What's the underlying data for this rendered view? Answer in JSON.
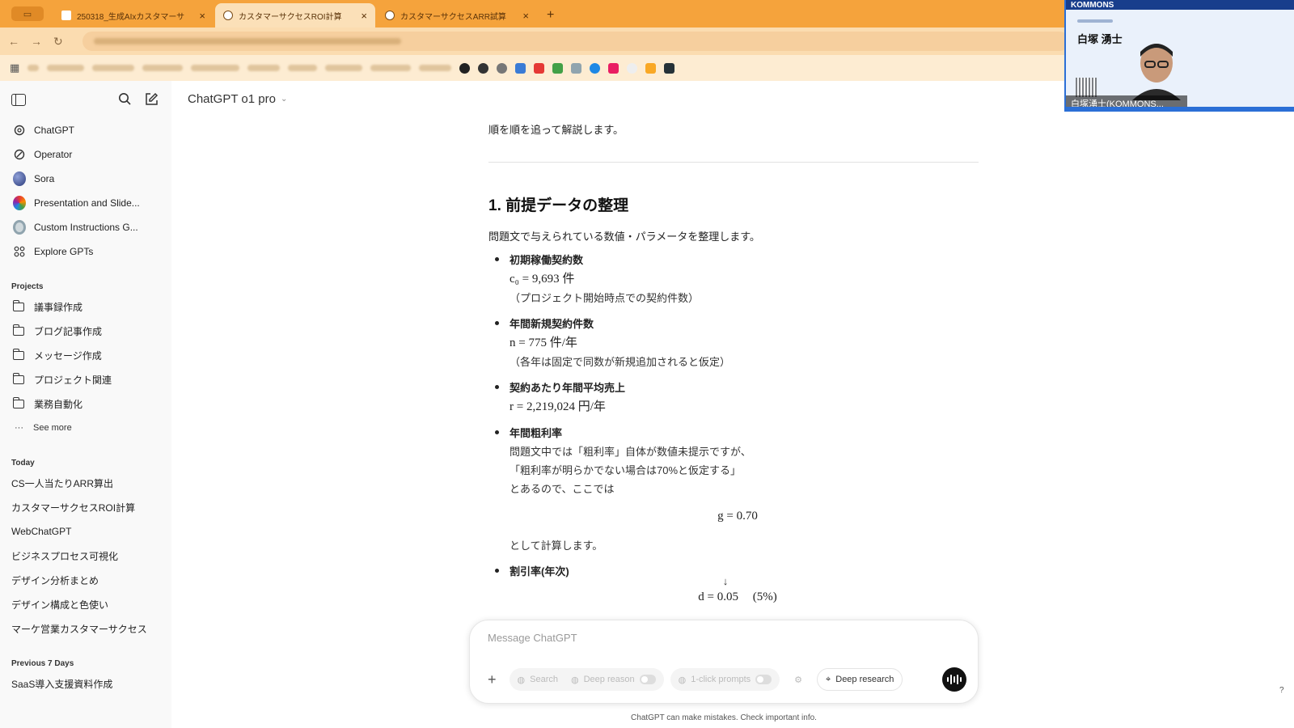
{
  "browser": {
    "tabs": [
      {
        "label": "250318_生成AIxカスタマーサ",
        "active": false
      },
      {
        "label": "カスタマーサクセスROI計算",
        "active": true
      },
      {
        "label": "カスタマーサクセスARR試算",
        "active": false
      }
    ]
  },
  "sidebar": {
    "top_items": [
      {
        "label": "ChatGPT",
        "icon": "openai-icon"
      },
      {
        "label": "Operator",
        "icon": "operator-icon"
      },
      {
        "label": "Sora",
        "icon": "sora-icon"
      },
      {
        "label": "Presentation and Slide...",
        "icon": "gpt-avatar-icon"
      },
      {
        "label": "Custom Instructions G...",
        "icon": "gpt-avatar-icon"
      },
      {
        "label": "Explore GPTs",
        "icon": "grid-icon"
      }
    ],
    "projects_title": "Projects",
    "projects": [
      "議事録作成",
      "ブログ記事作成",
      "メッセージ作成",
      "プロジェクト関連",
      "業務自動化"
    ],
    "see_more": "See more",
    "today_title": "Today",
    "today": [
      "CS一人当たりARR算出",
      "カスタマーサクセスROI計算",
      "WebChatGPT",
      "ビジネスプロセス可視化",
      "デザイン分析まとめ",
      "デザイン構成と色使い",
      "マーケ営業カスタマーサクセス"
    ],
    "prev7_title": "Previous 7 Days",
    "prev7": [
      "SaaS導入支援資料作成"
    ]
  },
  "header": {
    "model": "ChatGPT o1 pro"
  },
  "content": {
    "top_line": "順を順を追って解説します。",
    "heading": "1. 前提データの整理",
    "intro": "問題文で与えられている数値・パラメータを整理します。",
    "items": [
      {
        "title": "初期稼働契約数",
        "math": "c₀ = 9,693 件",
        "note": "（プロジェクト開始時点での契約件数）"
      },
      {
        "title": "年間新規契約件数",
        "math": "n = 775 件/年",
        "note": "（各年は固定で同数が新規追加されると仮定）"
      },
      {
        "title": "契約あたり年間平均売上",
        "math": "r = 2,219,024 円/年",
        "note": ""
      }
    ],
    "gross": {
      "title": "年間粗利率",
      "line1": "問題文中では「粗利率」自体が数値未提示ですが、",
      "line2": "「粗利率が明らかでない場合は70%と仮定する」",
      "line3": "とあるので、ここでは",
      "math": "g = 0.70",
      "after": "として計算します。"
    },
    "discount": {
      "title": "割引率(年次)",
      "math": "d = 0.05",
      "pct": "(5%)"
    }
  },
  "composer": {
    "placeholder": "Message ChatGPT",
    "search": "Search",
    "reason": "Deep reason",
    "prompts": "1-click prompts",
    "deep_research": "Deep research"
  },
  "footnote": "ChatGPT can make mistakes. Check important info.",
  "help": "?",
  "video": {
    "brand": "KOMMONS",
    "title": "白塚 湧士",
    "name_tag": "白塚湧士(KOMMONS..."
  }
}
